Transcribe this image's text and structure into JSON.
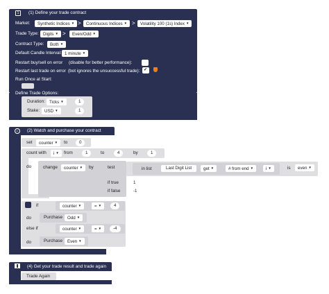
{
  "block1": {
    "title": "(1) Define your trade contract",
    "market_label": "Market:",
    "market_values": [
      "Synthetic Indices",
      "Continuous Indices",
      "Volatility 100 (1s) Index"
    ],
    "trade_type_label": "Trade Type:",
    "trade_type_values": [
      "Digits",
      "Even/Odd"
    ],
    "contract_type_label": "Contract Type:",
    "contract_type_value": "Both",
    "candle_label": "Default Candle Interval:",
    "candle_value": "1 minute",
    "restart_buy_label": "Restart buy/sell on error",
    "restart_buy_hint": "(disable for better performance):",
    "restart_buy_checked": false,
    "restart_last_label": "Restart last trade on error",
    "restart_last_hint": "(bot ignores the unsuccessful trade):",
    "restart_last_checked": true,
    "run_once_label": "Run Once at Start:",
    "define_options_label": "Define Trade Options:",
    "duration_label": "Duration:",
    "duration_unit": "Ticks",
    "duration_value": "1",
    "stake_label": "Stake:",
    "stake_currency": "USD",
    "stake_value": "1"
  },
  "block2": {
    "title": "(2) Watch and purchase your contract",
    "set_label": "set",
    "set_var": "counter",
    "to_label": "to",
    "set_value": "0",
    "count_with_label": "count with",
    "count_var": "i",
    "from_label": "from",
    "from_value": "1",
    "to2_label": "to",
    "to_value": "4",
    "by_label": "by",
    "by_value": "1",
    "do_label": "do",
    "change_label": "change",
    "change_var": "counter",
    "by2_label": "by",
    "test_label": "test",
    "in_list_label": "in list",
    "list_name": "Last Digit List",
    "get_value": "get",
    "from_end_value": "# from end",
    "index_var": "i",
    "is_label": "is",
    "is_value": "even",
    "if_true_label": "if true",
    "if_true_value": "1",
    "if_false_label": "if false",
    "if_false_value": "-1",
    "if_label": "if",
    "if_var": "counter",
    "if_op": "=",
    "if_value": "4",
    "do2_label": "do",
    "purchase_label": "Purchase",
    "purchase_odd": "Odd",
    "else_if_label": "else if",
    "elseif_var": "counter",
    "elseif_op": "=",
    "elseif_value": "-4",
    "do3_label": "do",
    "purchase_label2": "Purchase",
    "purchase_even": "Even"
  },
  "block4": {
    "title": "(4) Get your trade result and trade again",
    "trade_again_label": "Trade Again"
  },
  "colors": {
    "navy": "#2a3052",
    "light_block": "#dfdfe2",
    "accent": "#e98024"
  }
}
